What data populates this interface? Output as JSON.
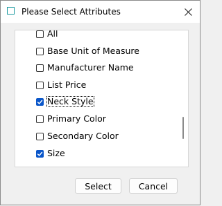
{
  "window": {
    "title": "Please Select Attributes"
  },
  "list": {
    "items": [
      {
        "label": "All",
        "checked": false
      },
      {
        "label": "Base Unit of Measure",
        "checked": false
      },
      {
        "label": "Manufacturer Name",
        "checked": false
      },
      {
        "label": "List Price",
        "checked": false
      },
      {
        "label": "Neck Style",
        "checked": true,
        "focused": true
      },
      {
        "label": "Primary Color",
        "checked": false
      },
      {
        "label": "Secondary Color",
        "checked": false
      },
      {
        "label": "Size",
        "checked": true
      }
    ]
  },
  "buttons": {
    "select": "Select",
    "cancel": "Cancel"
  },
  "colors": {
    "accent": "#0a56c9",
    "icon": "#1a9aa0"
  }
}
